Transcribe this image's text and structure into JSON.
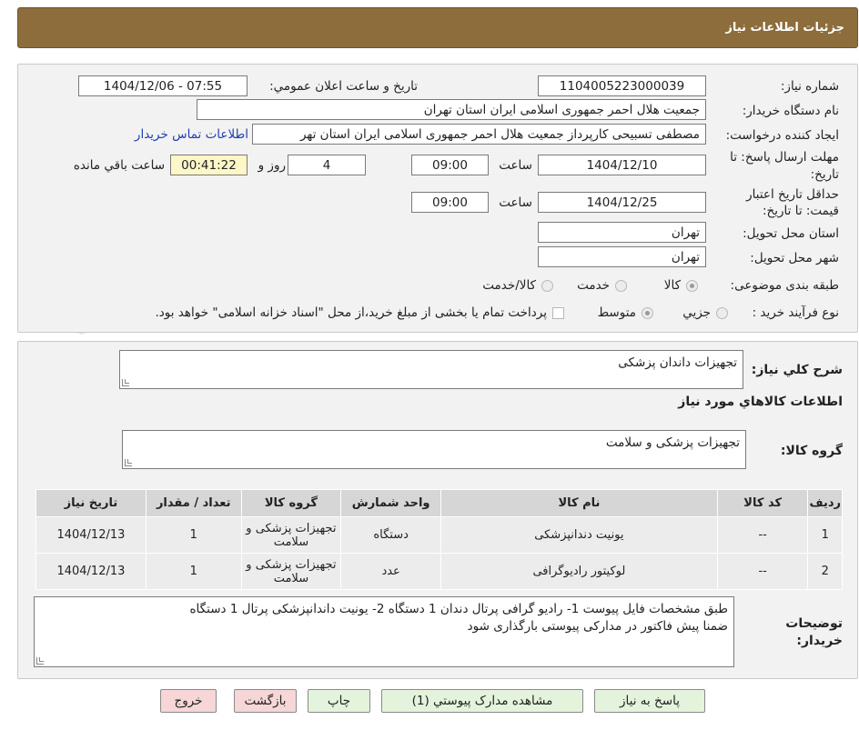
{
  "header": {
    "title": "جزئیات اطلاعات نیاز"
  },
  "form": {
    "need_number_label": "شماره نیاز:",
    "need_number": "1104005223000039",
    "announce_label": "تاریخ و ساعت اعلان عمومي:",
    "announce_value": "1404/12/06 - 07:55",
    "buyer_org_label": "نام دستگاه خریدار:",
    "buyer_org": "جمعیت هلال احمر جمهوری اسلامی ایران استان تهران",
    "requester_label": "ایجاد کننده درخواست:",
    "requester": "مصطفی تسبیحی کارپرداز جمعیت هلال احمر جمهوری اسلامی ایران استان تهر",
    "contact_link": "اطلاعات تماس خریدار",
    "deadline_label_1": "مهلت ارسال پاسخ: تا",
    "deadline_label_2": "تاریخ:",
    "deadline_date": "1404/12/10",
    "time_label": "ساعت",
    "deadline_time": "09:00",
    "days_value": "4",
    "days_label": "روز و",
    "remaining_time": "00:41:22",
    "remaining_label": "ساعت باقي مانده",
    "validity_label_1": "حداقل تاریخ اعتبار",
    "validity_label_2": "قیمت: تا تاریخ:",
    "validity_date": "1404/12/25",
    "validity_time": "09:00",
    "province_label": "استان محل تحویل:",
    "province": "تهران",
    "city_label": "شهر محل تحویل:",
    "city": "تهران",
    "category_label": "طبقه بندی موضوعی:",
    "category_options": [
      "کالا",
      "خدمت",
      "کالا/خدمت"
    ],
    "category_selected": "کالا",
    "process_label": "نوع فرآیند خرید :",
    "process_options": [
      "جزیي",
      "متوسط"
    ],
    "process_selected": "متوسط",
    "payment_note": "پرداخت تمام یا بخشی از مبلغ خرید،از محل \"اسناد خزانه اسلامی\" خواهد بود."
  },
  "summary": {
    "general_desc_label": "شرح کلي نیاز:",
    "general_desc": "تجهیزات داندان پزشکی",
    "goods_info_title": "اطلاعات کالاهاي مورد نیاز",
    "goods_group_label": "گروه کالا:",
    "goods_group": "تجهیزات پزشکی و سلامت"
  },
  "table": {
    "headers": [
      "ردیف",
      "کد کالا",
      "نام کالا",
      "واحد شمارش",
      "گروه کالا",
      "تعداد / مقدار",
      "تاریخ نیاز"
    ],
    "rows": [
      [
        "1",
        "--",
        "یونیت دندانپزشکی",
        "دستگاه",
        "تجهیزات پزشکی و سلامت",
        "1",
        "1404/12/13"
      ],
      [
        "2",
        "--",
        "لوکیتور رادیوگرافی",
        "عدد",
        "تجهیزات پزشکی و سلامت",
        "1",
        "1404/12/13"
      ]
    ]
  },
  "buyer_notes": {
    "label_1": "توضیحات",
    "label_2": "خریدار:",
    "line_1": "طبق مشخصات فایل پیوست  1- رادیو گرافی پرتال دندان  1 دستگاه  2-  یونیت داندانپزشکی پرتال 1 دستگاه",
    "line_2": "ضمنا پیش فاکتور در مدارکی پیوستی بارگذاری شود"
  },
  "buttons": {
    "reply": "پاسخ به نیاز",
    "attachments": "مشاهده مدارک پیوستي (1)",
    "print": "چاپ",
    "back": "بازگشت",
    "exit": "خروج"
  },
  "watermark": {
    "text": "AriaTender.neT"
  },
  "colors": {
    "header": "#8c6d3b",
    "panel": "#f2f2f2",
    "link": "#1f3fb5",
    "button_green": "#e4f3dc",
    "button_pink": "#f6d6d6"
  }
}
